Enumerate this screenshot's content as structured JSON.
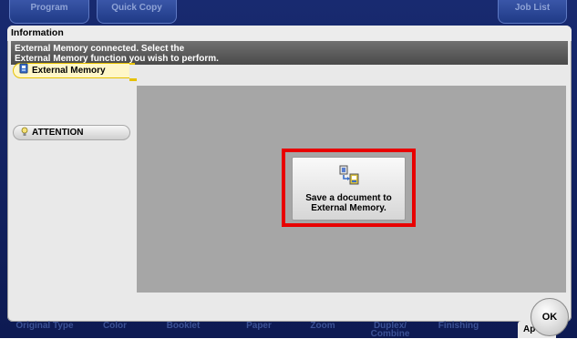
{
  "top_tabs": [
    {
      "label": "Program"
    },
    {
      "label": "Quick Copy"
    },
    {
      "label": "Job List"
    }
  ],
  "info": {
    "title": "Information",
    "message_line1": "External Memory connected. Select the",
    "message_line2": "External Memory function you wish to perform."
  },
  "side_tabs": {
    "external_memory": "External Memory",
    "attention": "ATTENTION"
  },
  "function": {
    "line1": "Save a document to",
    "line2": "External Memory.",
    "icon": "save-to-memory-icon"
  },
  "bottom_tabs": [
    {
      "label": "Original Type"
    },
    {
      "label": "Color"
    },
    {
      "label": "Booklet"
    },
    {
      "label": "Paper"
    },
    {
      "label": "Zoom"
    },
    {
      "label_line1": "Duplex/",
      "label_line2": "Combine"
    },
    {
      "label": "Finishing"
    }
  ],
  "apply_tab": "Ap",
  "ok_label": "OK",
  "colors": {
    "frame": "#1a2a6a",
    "highlight": "#e80000",
    "active_tab": "#e6c100"
  }
}
